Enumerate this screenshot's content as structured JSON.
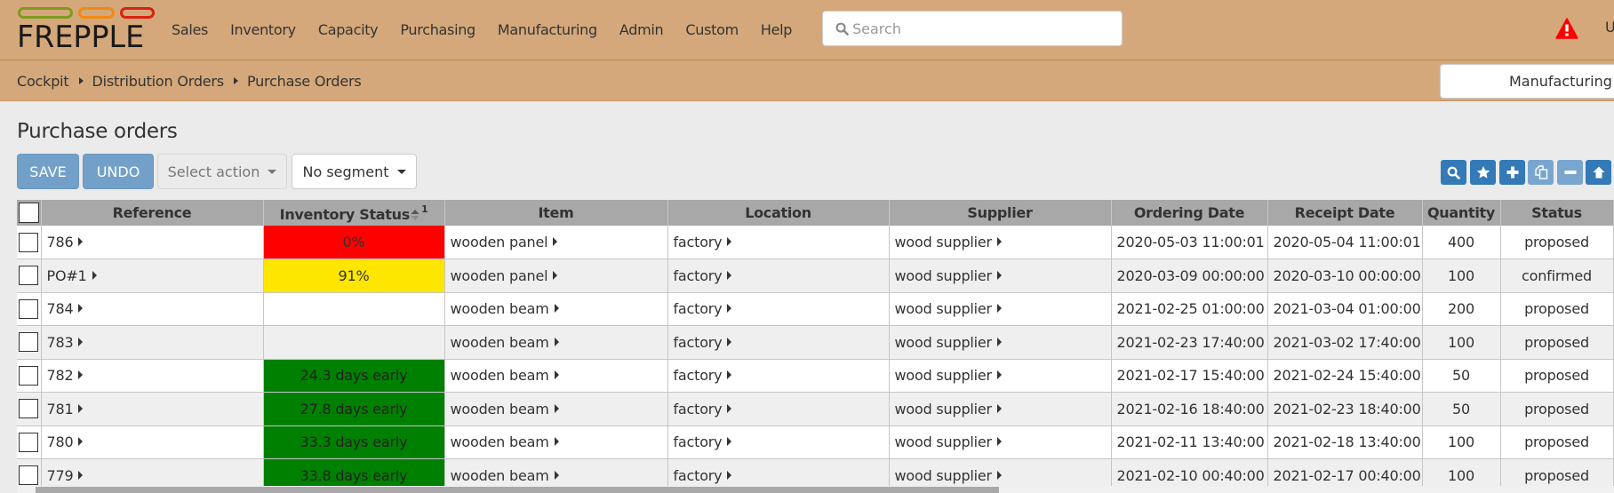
{
  "navbar": {
    "logo_text": "FREPPLE",
    "logo_colors": [
      "#7f9a1e",
      "#f08a12",
      "#d9230f"
    ],
    "menu": [
      "Sales",
      "Inventory",
      "Capacity",
      "Purchasing",
      "Manufacturing",
      "Admin",
      "Custom",
      "Help"
    ],
    "search_placeholder": "Search",
    "warning_icon": "exclamation-triangle-icon",
    "user_initial": "U"
  },
  "breadcrumb": {
    "items": [
      "Cockpit",
      "Distribution Orders",
      "Purchase Orders"
    ],
    "mode_selector": "Manufacturing"
  },
  "page": {
    "title": "Purchase orders"
  },
  "toolbar": {
    "save_label": "SAVE",
    "undo_label": "UNDO",
    "select_action_label": "Select action",
    "segment_label": "No segment",
    "icon_buttons": [
      {
        "icon": "search-icon",
        "enabled": true
      },
      {
        "icon": "star-icon",
        "enabled": true
      },
      {
        "icon": "plus-icon",
        "enabled": true
      },
      {
        "icon": "copy-icon",
        "enabled": false
      },
      {
        "icon": "minus-icon",
        "enabled": false
      },
      {
        "icon": "arrow-up-icon",
        "enabled": true
      }
    ]
  },
  "table": {
    "columns": [
      "Reference",
      "Inventory Status",
      "Item",
      "Location",
      "Supplier",
      "Ordering Date",
      "Receipt Date",
      "Quantity",
      "Status"
    ],
    "sort_column": "Inventory Status",
    "sort_index": "1",
    "rows": [
      {
        "reference": "786",
        "inventory_status": "0%",
        "status_color": "red",
        "item": "wooden panel",
        "location": "factory",
        "supplier": "wood supplier",
        "ordering_date": "2020-05-03 11:00:01",
        "receipt_date": "2020-05-04 11:00:01",
        "quantity": "400",
        "status": "proposed"
      },
      {
        "reference": "PO#1",
        "inventory_status": "91%",
        "status_color": "yellow",
        "item": "wooden panel",
        "location": "factory",
        "supplier": "wood supplier",
        "ordering_date": "2020-03-09 00:00:00",
        "receipt_date": "2020-03-10 00:00:00",
        "quantity": "100",
        "status": "confirmed"
      },
      {
        "reference": "784",
        "inventory_status": "",
        "status_color": "none",
        "item": "wooden beam",
        "location": "factory",
        "supplier": "wood supplier",
        "ordering_date": "2021-02-25 01:00:00",
        "receipt_date": "2021-03-04 01:00:00",
        "quantity": "200",
        "status": "proposed"
      },
      {
        "reference": "783",
        "inventory_status": "",
        "status_color": "none",
        "item": "wooden beam",
        "location": "factory",
        "supplier": "wood supplier",
        "ordering_date": "2021-02-23 17:40:00",
        "receipt_date": "2021-03-02 17:40:00",
        "quantity": "100",
        "status": "proposed"
      },
      {
        "reference": "782",
        "inventory_status": "24.3 days early",
        "status_color": "green",
        "item": "wooden beam",
        "location": "factory",
        "supplier": "wood supplier",
        "ordering_date": "2021-02-17 15:40:00",
        "receipt_date": "2021-02-24 15:40:00",
        "quantity": "50",
        "status": "proposed"
      },
      {
        "reference": "781",
        "inventory_status": "27.8 days early",
        "status_color": "green",
        "item": "wooden beam",
        "location": "factory",
        "supplier": "wood supplier",
        "ordering_date": "2021-02-16 18:40:00",
        "receipt_date": "2021-02-23 18:40:00",
        "quantity": "50",
        "status": "proposed"
      },
      {
        "reference": "780",
        "inventory_status": "33.3 days early",
        "status_color": "green",
        "item": "wooden beam",
        "location": "factory",
        "supplier": "wood supplier",
        "ordering_date": "2021-02-11 13:40:00",
        "receipt_date": "2021-02-18 13:40:00",
        "quantity": "100",
        "status": "proposed"
      },
      {
        "reference": "779",
        "inventory_status": "33.8 days early",
        "status_color": "green",
        "item": "wooden beam",
        "location": "factory",
        "supplier": "wood supplier",
        "ordering_date": "2021-02-10 00:40:00",
        "receipt_date": "2021-02-17 00:40:00",
        "quantity": "100",
        "status": "proposed"
      }
    ]
  },
  "colors": {
    "navbar_bg": "#d4a87a",
    "primary_button": "#72a0c9",
    "icon_button": "#337ab7",
    "status_red": "#ff0000",
    "status_yellow": "#ffe600",
    "status_green": "#008000",
    "warning": "#ff0000"
  }
}
